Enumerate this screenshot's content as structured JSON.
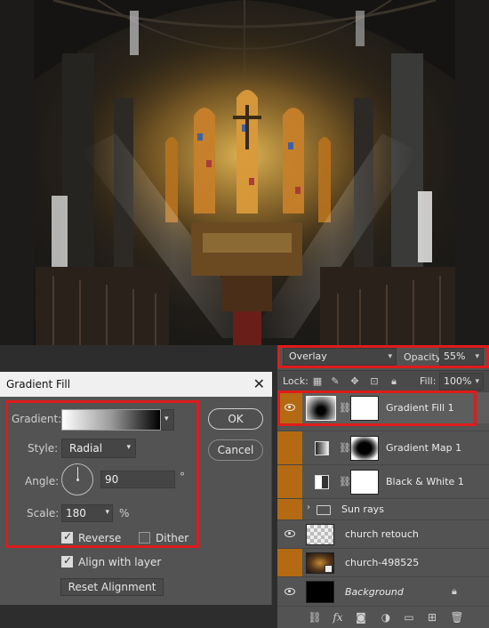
{
  "photo": {
    "description_icon": "church-interior-photo"
  },
  "layers_panel": {
    "blend_mode": "Overlay",
    "opacity_label": "Opacity:",
    "opacity_value": "55%",
    "lock_label": "Lock:",
    "fill_label": "Fill:",
    "fill_value": "100%",
    "layers": [
      {
        "name": "Gradient Fill 1",
        "italic": false
      },
      {
        "name": "Gradient Map 1",
        "italic": false
      },
      {
        "name": "Black & White 1",
        "italic": false
      },
      {
        "name": "Sun rays",
        "italic": false
      },
      {
        "name": "church retouch",
        "italic": false
      },
      {
        "name": "church-498525",
        "italic": false
      },
      {
        "name": "Background",
        "italic": true
      }
    ],
    "bottom_icons": [
      "link-icon",
      "fx-icon",
      "mask-icon",
      "adjustment-icon",
      "folder-icon",
      "new-layer-icon",
      "trash-icon"
    ],
    "fx_label": "fx"
  },
  "dialog": {
    "title": "Gradient Fill",
    "close_glyph": "✕",
    "gradient_label": "Gradient:",
    "style_label": "Style:",
    "style_value": "Radial",
    "angle_label": "Angle:",
    "angle_value": "90",
    "angle_unit": "°",
    "scale_label": "Scale:",
    "scale_value": "180",
    "scale_unit": "%",
    "reverse_label": "Reverse",
    "reverse_checked": true,
    "dither_label": "Dither",
    "dither_checked": false,
    "align_label": "Align with layer",
    "align_checked": true,
    "reset_label": "Reset Alignment",
    "ok_label": "OK",
    "cancel_label": "Cancel"
  },
  "colors": {
    "highlight_red": "#e01b1b",
    "layer_orange": "#b46a12",
    "panel_gray": "#535353"
  }
}
